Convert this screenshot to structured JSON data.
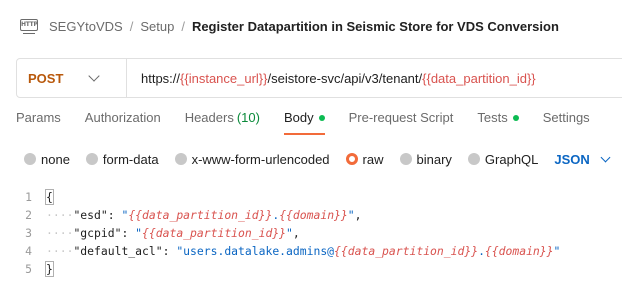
{
  "breadcrumb": {
    "items": [
      "SEGYtoVDS",
      "Setup"
    ],
    "separator": "/",
    "current": "Register Datapartition in Seismic Store for VDS Conversion"
  },
  "request": {
    "method": "POST",
    "url_prefix": "https://",
    "url_var1": "{{instance_url}}",
    "url_middle": "/seistore-svc/api/v3/tenant/",
    "url_var2": "{{data_partition_id}}"
  },
  "tabs": [
    {
      "label": "Params"
    },
    {
      "label": "Authorization"
    },
    {
      "label": "Headers",
      "count": "(10)"
    },
    {
      "label": "Body"
    },
    {
      "label": "Pre-request Script"
    },
    {
      "label": "Tests"
    },
    {
      "label": "Settings"
    }
  ],
  "body_options": [
    "none",
    "form-data",
    "x-www-form-urlencoded",
    "raw",
    "binary",
    "GraphQL"
  ],
  "body_format": "JSON",
  "editor": {
    "line_numbers": [
      "1",
      "2",
      "3",
      "4",
      "5"
    ],
    "open_brace": "{",
    "close_brace": "}",
    "indent": "····",
    "l2_key": "\"esd\"",
    "l2_colon": ": ",
    "l2_q1": "\"",
    "l2_var1": "{{data_partition_id}}",
    "l2_dot": ".",
    "l2_var2": "{{domain}}",
    "l2_q2": "\"",
    "l2_comma": ",",
    "l3_key": "\"gcpid\"",
    "l3_colon": ": ",
    "l3_q1": "\"",
    "l3_var1": "{{data_partition_id}}",
    "l3_q2": "\"",
    "l3_comma": ",",
    "l4_key": "\"default_acl\"",
    "l4_colon": ": ",
    "l4_str1": "\"users.datalake.admins@",
    "l4_var1": "{{data_partition_id}}",
    "l4_dot": ".",
    "l4_var2": "{{domain}}",
    "l4_q2": "\""
  },
  "colors": {
    "method": "#b8580b",
    "variable": "#d9534f",
    "string": "#0b66c3",
    "accent": "#f26b3a",
    "status_dot": "#0cbb52"
  }
}
